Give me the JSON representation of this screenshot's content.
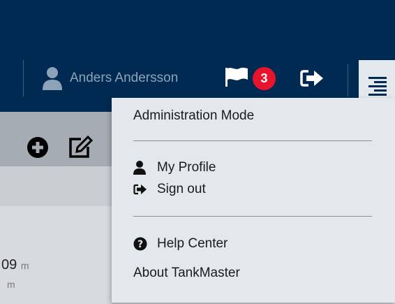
{
  "header": {
    "user_name": "Anders Andersson",
    "notification_count": "3",
    "icons": [
      "user-icon",
      "flag-icon",
      "sign-out-icon",
      "menu-icon"
    ]
  },
  "toolbar": {
    "icons": [
      "add-circle-icon",
      "edit-icon"
    ]
  },
  "background": {
    "value_1": "09",
    "unit_1": "m",
    "unit_2": "m"
  },
  "dropdown": {
    "admin_mode": "Administration Mode",
    "my_profile": "My Profile",
    "sign_out": "Sign out",
    "help_center": "Help Center",
    "about": "About TankMaster"
  },
  "colors": {
    "header_bg": "#012a52",
    "badge": "#e8132d",
    "menu_bg": "#e3e8ec"
  }
}
